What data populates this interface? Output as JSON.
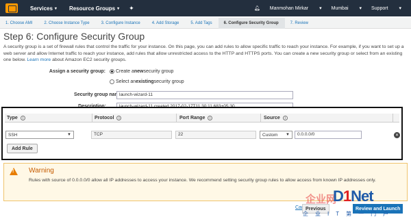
{
  "nav": {
    "services": "Services",
    "resource_groups": "Resource Groups",
    "user": "Manmohan Mirkar",
    "region": "Mumbai",
    "support": "Support"
  },
  "wizard": {
    "tabs": [
      "1. Choose AMI",
      "2. Choose Instance Type",
      "3. Configure Instance",
      "4. Add Storage",
      "5. Add Tags",
      "6. Configure Security Group",
      "7. Review"
    ],
    "active_index": 5
  },
  "page": {
    "title": "Step 6: Configure Security Group",
    "description": "A security group is a set of firewall rules that control the traffic for your instance. On this page, you can add rules to allow specific traffic to reach your instance. For example, if you want to set up a web server and allow Internet traffic to reach your instance, add rules that allow unrestricted access to the HTTP and HTTPS ports. You can create a new security group or select from an existing one below.",
    "learn_more": "Learn more",
    "learn_more_suffix": "about Amazon EC2 security groups."
  },
  "form": {
    "assign_label": "Assign a security group:",
    "option_create_prefix": "Create a ",
    "option_create_bold": "new",
    "option_create_suffix": " security group",
    "option_select_prefix": "Select an ",
    "option_select_bold": "existing",
    "option_select_suffix": " security group",
    "selected_option": "create",
    "name_label": "Security group name:",
    "name_value": "launch-wizard-11",
    "description_label": "Description:",
    "description_value": "launch-wizard-11 created 2017-02-17T11:30:11.683+05:30"
  },
  "rules_table": {
    "headers": {
      "type": "Type",
      "protocol": "Protocol",
      "port_range": "Port Range",
      "source": "Source"
    },
    "rows": [
      {
        "type": "SSH",
        "protocol": "TCP",
        "port_range": "22",
        "source_mode": "Custom",
        "source_value": "0.0.0.0/0"
      }
    ],
    "add_rule_label": "Add Rule"
  },
  "warning": {
    "title": "Warning",
    "text": "Rules with source of 0.0.0.0/0 allow all IP addresses to access your instance. We recommend setting security group rules to allow access from known IP addresses only."
  },
  "footer": {
    "cancel": "Cancel",
    "previous": "Previous",
    "review": "Review and Launch"
  },
  "watermark": {
    "brand_left": "企业网",
    "brand_d": "D",
    "brand_one": "1",
    "brand_net": "Net",
    "tagline": "企业IT第一门户"
  },
  "colors": {
    "nav_bg": "#232f3e",
    "link": "#1a73b8",
    "warning_title": "#c55b00",
    "warning_bg": "#fff8e6",
    "primary_button": "#1a73b8"
  }
}
